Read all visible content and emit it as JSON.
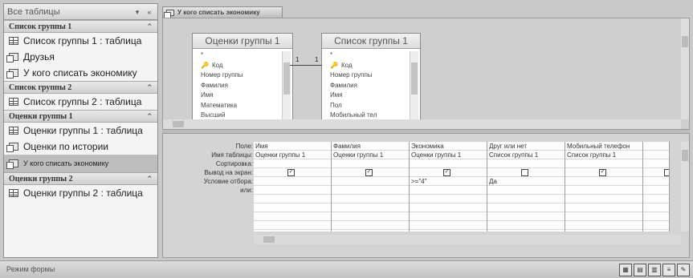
{
  "nav": {
    "header_title": "Все таблицы",
    "groups": [
      {
        "title": "Список группы 1",
        "items": [
          {
            "label": "Список группы 1 : таблица",
            "icon": "table-icon"
          },
          {
            "label": "Друзья",
            "icon": "query-icon"
          },
          {
            "label": "У кого списать экономику",
            "icon": "query-icon"
          }
        ]
      },
      {
        "title": "Список группы 2",
        "items": [
          {
            "label": "Список группы 2 : таблица",
            "icon": "table-icon"
          }
        ]
      },
      {
        "title": "Оценки группы 1",
        "items": [
          {
            "label": "Оценки группы 1 : таблица",
            "icon": "table-icon"
          },
          {
            "label": "Оценки по истории",
            "icon": "query-icon"
          },
          {
            "label": "У кого списать экономику",
            "icon": "query-icon",
            "selected": true
          }
        ]
      },
      {
        "title": "Оценки группы 2",
        "items": [
          {
            "label": "Оценки группы 2 : таблица",
            "icon": "table-icon"
          }
        ]
      }
    ]
  },
  "tab": {
    "label": "У кого списать экономику"
  },
  "tables": [
    {
      "title": "Оценки группы 1",
      "fields": [
        "*",
        "Код",
        "Номер группы",
        "Фамилия",
        "Имя",
        "Математика",
        "Высший"
      ]
    },
    {
      "title": "Список группы 1",
      "fields": [
        "*",
        "Код",
        "Номер группы",
        "Фамилия",
        "Имя",
        "Пол",
        "Мобильный тел"
      ]
    }
  ],
  "relationship": {
    "left": "1",
    "right": "1"
  },
  "grid": {
    "row_labels": [
      "Поле:",
      "Имя таблицы:",
      "Сортировка:",
      "Вывод на экран:",
      "Условие отбора:",
      "или:"
    ],
    "columns": [
      {
        "field": "Имя",
        "table": "Оценки группы 1",
        "sort": "",
        "show": true,
        "criteria": "",
        "or": ""
      },
      {
        "field": "Фамилия",
        "table": "Оценки группы 1",
        "sort": "",
        "show": true,
        "criteria": "",
        "or": ""
      },
      {
        "field": "Экономика",
        "table": "Оценки группы 1",
        "sort": "",
        "show": true,
        "criteria": ">=\"4\"",
        "or": ""
      },
      {
        "field": "Друг или нет",
        "table": "Список группы 1",
        "sort": "",
        "show": false,
        "criteria": "Да",
        "or": ""
      },
      {
        "field": "Мобильный телефон",
        "table": "Список группы 1",
        "sort": "",
        "show": true,
        "criteria": "",
        "or": ""
      }
    ]
  },
  "status": {
    "text": "Режим формы"
  }
}
